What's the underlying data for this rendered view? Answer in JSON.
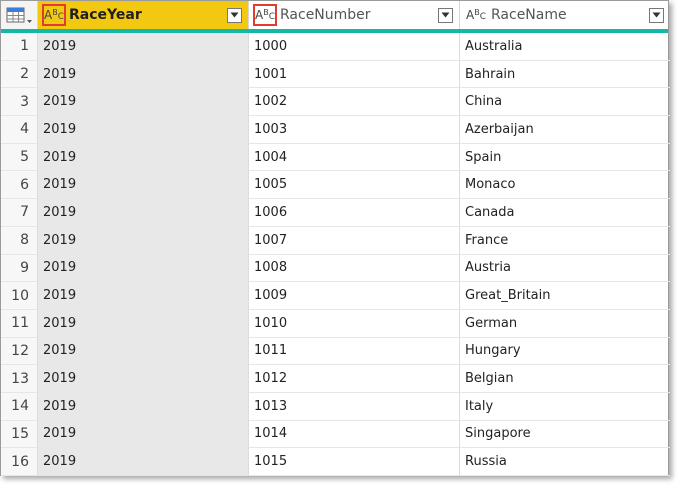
{
  "columns": [
    {
      "name": "RaceYear",
      "type_icon": "text-type-icon",
      "selected": true
    },
    {
      "name": "RaceNumber",
      "type_icon": "text-type-icon",
      "selected": false
    },
    {
      "name": "RaceName",
      "type_icon": "text-type-icon",
      "selected": false
    }
  ],
  "type_glyph": {
    "a": "A",
    "b": "B",
    "c": "C"
  },
  "colors": {
    "selected_header": "#f2c811",
    "quality_bar": "#14b8a6",
    "highlight_box": "#e03c31"
  },
  "rows": [
    {
      "n": "1",
      "year": "2019",
      "number": "1000",
      "name": "Australia"
    },
    {
      "n": "2",
      "year": "2019",
      "number": "1001",
      "name": "Bahrain"
    },
    {
      "n": "3",
      "year": "2019",
      "number": "1002",
      "name": "China"
    },
    {
      "n": "4",
      "year": "2019",
      "number": "1003",
      "name": "Azerbaijan"
    },
    {
      "n": "5",
      "year": "2019",
      "number": "1004",
      "name": "Spain"
    },
    {
      "n": "6",
      "year": "2019",
      "number": "1005",
      "name": "Monaco"
    },
    {
      "n": "7",
      "year": "2019",
      "number": "1006",
      "name": "Canada"
    },
    {
      "n": "8",
      "year": "2019",
      "number": "1007",
      "name": "France"
    },
    {
      "n": "9",
      "year": "2019",
      "number": "1008",
      "name": "Austria"
    },
    {
      "n": "10",
      "year": "2019",
      "number": "1009",
      "name": "Great_Britain"
    },
    {
      "n": "11",
      "year": "2019",
      "number": "1010",
      "name": "German"
    },
    {
      "n": "12",
      "year": "2019",
      "number": "1011",
      "name": "Hungary"
    },
    {
      "n": "13",
      "year": "2019",
      "number": "1012",
      "name": "Belgian"
    },
    {
      "n": "14",
      "year": "2019",
      "number": "1013",
      "name": "Italy"
    },
    {
      "n": "15",
      "year": "2019",
      "number": "1014",
      "name": "Singapore"
    },
    {
      "n": "16",
      "year": "2019",
      "number": "1015",
      "name": "Russia"
    }
  ]
}
